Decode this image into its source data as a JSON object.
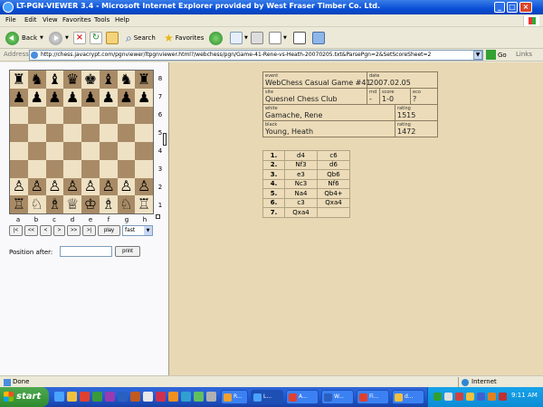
{
  "window": {
    "title": "LT-PGN-VIEWER 3.4 - Microsoft Internet Explorer provided by West Fraser Timber Co. Ltd."
  },
  "menu": [
    "File",
    "Edit",
    "View",
    "Favorites",
    "Tools",
    "Help"
  ],
  "toolbar": {
    "back_label": "Back",
    "search_label": "Search",
    "favorites_label": "Favorites"
  },
  "address": {
    "label": "Address",
    "url": "http://chess.javacrypt.com/pgnviewer/ltpgnviewer.html?/webchess/pgn/Game-41-Rene-vs-Heath-20070205.txt&ParsePgn=2&SetScoreSheet=2",
    "go_label": "Go",
    "links_label": "Links"
  },
  "board": {
    "ranks": [
      "8",
      "7",
      "6",
      "5",
      "4",
      "3",
      "2",
      "1"
    ],
    "files": [
      "a",
      "b",
      "c",
      "d",
      "e",
      "f",
      "g",
      "h"
    ],
    "position": [
      [
        "♜",
        "♞",
        "♝",
        "♛",
        "♚",
        "♝",
        "♞",
        "♜"
      ],
      [
        "♟",
        "♟",
        "♟",
        "♟",
        "♟",
        "♟",
        "♟",
        "♟"
      ],
      [
        "",
        "",
        "",
        "",
        "",
        "",
        "",
        ""
      ],
      [
        "",
        "",
        "",
        "",
        "",
        "",
        "",
        ""
      ],
      [
        "",
        "",
        "",
        "",
        "",
        "",
        "",
        ""
      ],
      [
        "",
        "",
        "",
        "",
        "",
        "",
        "",
        ""
      ],
      [
        "♙",
        "♙",
        "♙",
        "♙",
        "♙",
        "♙",
        "♙",
        "♙"
      ],
      [
        "♖",
        "♘",
        "♗",
        "♕",
        "♔",
        "♗",
        "♘",
        "♖"
      ]
    ]
  },
  "controls": {
    "first": "|<",
    "prev_many": "<<",
    "prev": "<",
    "next": ">",
    "next_many": ">>",
    "last": ">|",
    "play": "play",
    "speed": "fast",
    "position_after_label": "Position after:",
    "print": "print"
  },
  "game": {
    "event_label": "event",
    "event": "WebChess Casual Game #41",
    "date_label": "date",
    "date": "2007.02.05",
    "site_label": "site",
    "site": "Quesnel Chess Club",
    "rnd_label": "rnd",
    "rnd": "-",
    "score_label": "score",
    "score": "1-0",
    "eco_label": "eco",
    "eco": "?",
    "white_label": "white",
    "white": "Gamache, Rene",
    "white_rating_label": "rating",
    "white_rating": "1515",
    "black_label": "black",
    "black": "Young, Heath",
    "black_rating_label": "rating",
    "black_rating": "1472"
  },
  "moves": [
    {
      "num": "1.",
      "white": "d4",
      "black": "c6"
    },
    {
      "num": "2.",
      "white": "Nf3",
      "black": "d6"
    },
    {
      "num": "3.",
      "white": "e3",
      "black": "Qb6"
    },
    {
      "num": "4.",
      "white": "Nc3",
      "black": "Nf6"
    },
    {
      "num": "5.",
      "white": "Na4",
      "black": "Qb4+"
    },
    {
      "num": "6.",
      "white": "c3",
      "black": "Qxa4"
    },
    {
      "num": "7.",
      "white": "Qxa4",
      "black": ""
    }
  ],
  "status": {
    "text": "Done",
    "zone": "Internet"
  },
  "taskbar": {
    "start": "start",
    "tasks": [
      "R...",
      "L...",
      "A...",
      "W...",
      "Fi...",
      "d..."
    ],
    "clock": "9:11 AM"
  }
}
